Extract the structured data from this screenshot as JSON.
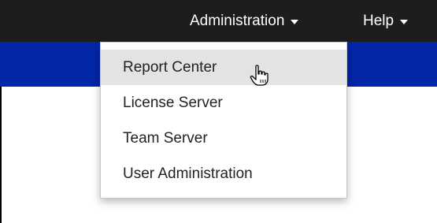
{
  "navbar": {
    "menus": [
      {
        "label": "Administration",
        "icon": "caret-down-icon",
        "expanded": true
      },
      {
        "label": "Help",
        "icon": "caret-down-icon",
        "expanded": false
      }
    ]
  },
  "dropdown": {
    "items": [
      {
        "label": "Report Center",
        "hovered": true
      },
      {
        "label": "License Server",
        "hovered": false
      },
      {
        "label": "Team Server",
        "hovered": false
      },
      {
        "label": "User Administration",
        "hovered": false
      }
    ]
  },
  "cursor": {
    "icon": "hand-pointer-icon"
  },
  "colors": {
    "navbar_bg": "#1d1d1d",
    "band_bg": "#0325a8",
    "hover_bg": "#e3e3e3",
    "menu_text": "#ffffff",
    "item_text": "#222222"
  }
}
